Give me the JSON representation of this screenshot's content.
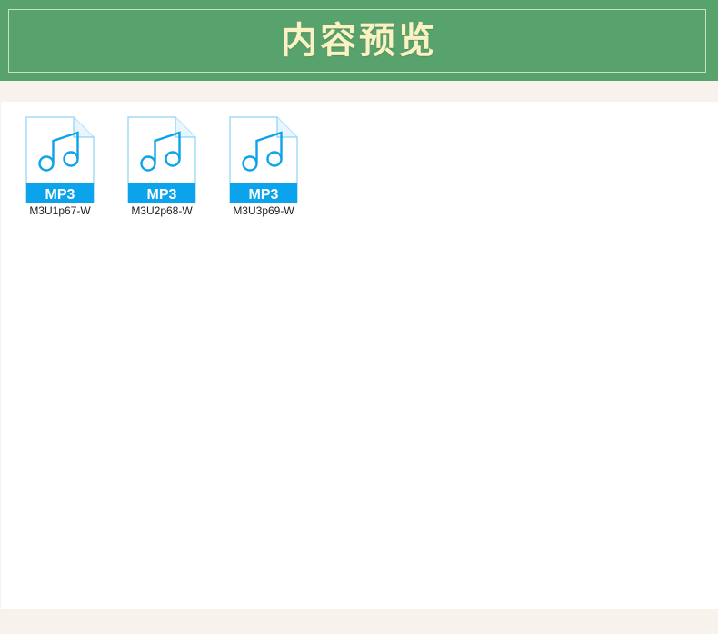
{
  "header": {
    "title": "内容预览"
  },
  "files": [
    {
      "name": "M3U1p67-W",
      "type_label": "MP3",
      "icon": "music-note-icon"
    },
    {
      "name": "M3U2p68-W",
      "type_label": "MP3",
      "icon": "music-note-icon"
    },
    {
      "name": "M3U3p69-W",
      "type_label": "MP3",
      "icon": "music-note-icon"
    }
  ],
  "colors": {
    "header_bg": "#58a26e",
    "title_text": "#fbf2c4",
    "page_bg": "#f7f3ec",
    "icon_blue": "#0aa3ec",
    "icon_outline": "#8fd3f5"
  }
}
